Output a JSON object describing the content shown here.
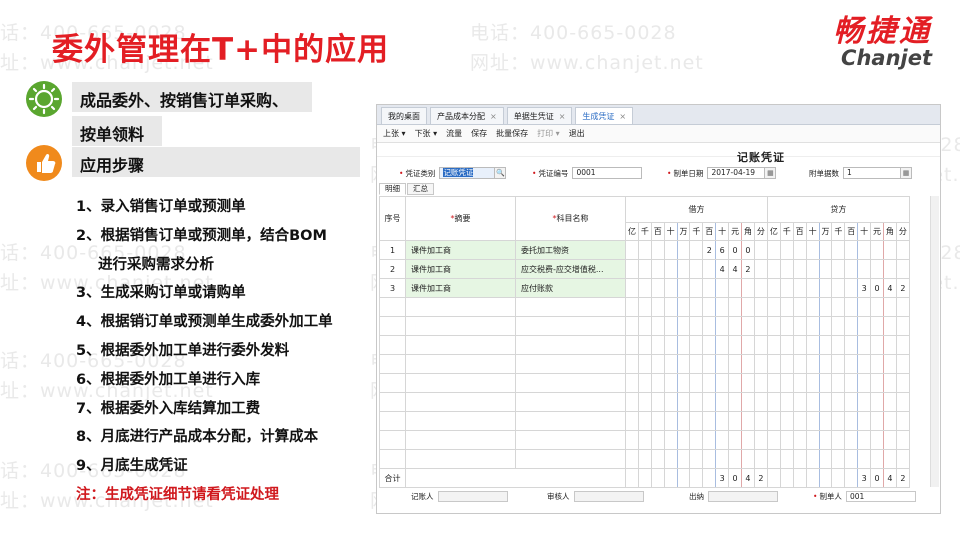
{
  "slide": {
    "title": "委外管理在T+中的应用",
    "logo_cn": "畅捷通",
    "logo_en": "Chanjet",
    "watermark_phone": "电话：400-665-0028",
    "watermark_url": "网址：www.chanjet.net",
    "section1_line1": "成品委外、按销售订单采购、",
    "section1_line2": "按单领料",
    "section2": "应用步骤",
    "steps": [
      "1、录入销售订单或预测单",
      "2、根据销售订单或预测单，结合BOM",
      "进行采购需求分析",
      "3、生成采购订单或请购单",
      "4、根据销订单或预测单生成委外加工单",
      "5、根据委外加工单进行委外发料",
      "6、根据委外加工单进行入库",
      "7、根据委外入库结算加工费",
      "8、月底进行产品成本分配，计算成本",
      "9、月底生成凭证"
    ],
    "note": "注：生成凭证细节请看凭证处理",
    "accent": "#e31e24"
  },
  "app": {
    "tabs": [
      "我的桌面",
      "产品成本分配",
      "单据生凭证",
      "生成凭证"
    ],
    "tab_close": "×",
    "toolbar": [
      "上张 ▾",
      "下张 ▾",
      "流量",
      "保存",
      "批量保存",
      "打印 ▾",
      "退出"
    ],
    "voucher_title": "记账凭证",
    "form": {
      "type_label": "凭证类别",
      "type_value": "记账凭证",
      "no_label": "凭证编号",
      "no_value": "0001",
      "date_label": "制单日期",
      "date_value": "2017-04-19",
      "attach_label": "附单据数",
      "attach_value": "1"
    },
    "subtabs": [
      "明细",
      "汇总"
    ],
    "columns": {
      "seq": "序号",
      "summary": "摘要",
      "account": "科目名称",
      "debit": "借方",
      "credit": "贷方",
      "digits": [
        "亿",
        "千",
        "百",
        "十",
        "万",
        "千",
        "百",
        "十",
        "元",
        "角",
        "分"
      ]
    },
    "rows": [
      {
        "seq": "1",
        "summary": "课件加工商",
        "account": "委托加工物资",
        "debit": [
          "",
          "",
          "",
          "",
          "",
          "",
          "2",
          "6",
          "0",
          "0",
          ""
        ],
        "credit": [
          "",
          "",
          "",
          "",
          "",
          "",
          "",
          "",
          "",
          "",
          ""
        ]
      },
      {
        "seq": "2",
        "summary": "课件加工商",
        "account": "应交税费-应交增值税...",
        "debit": [
          "",
          "",
          "",
          "",
          "",
          "",
          "",
          "4",
          "4",
          "2",
          ""
        ],
        "credit": [
          "",
          "",
          "",
          "",
          "",
          "",
          "",
          "",
          "",
          "",
          ""
        ]
      },
      {
        "seq": "3",
        "summary": "课件加工商",
        "account": "应付账款",
        "debit": [
          "",
          "",
          "",
          "",
          "",
          "",
          "",
          "",
          "",
          "",
          ""
        ],
        "credit": [
          "",
          "",
          "",
          "",
          "",
          "",
          "",
          "3",
          "0",
          "4",
          "2"
        ]
      }
    ],
    "total_label": "合计",
    "total_debit": [
      "",
      "",
      "",
      "",
      "",
      "",
      "",
      "3",
      "0",
      "4",
      "2"
    ],
    "total_credit": [
      "",
      "",
      "",
      "",
      "",
      "",
      "",
      "3",
      "0",
      "4",
      "2"
    ],
    "footer": {
      "bookkeeper_label": "记账人",
      "auditor_label": "审核人",
      "cashier_label": "出纳",
      "maker_label": "制单人",
      "maker_value": "001"
    }
  }
}
